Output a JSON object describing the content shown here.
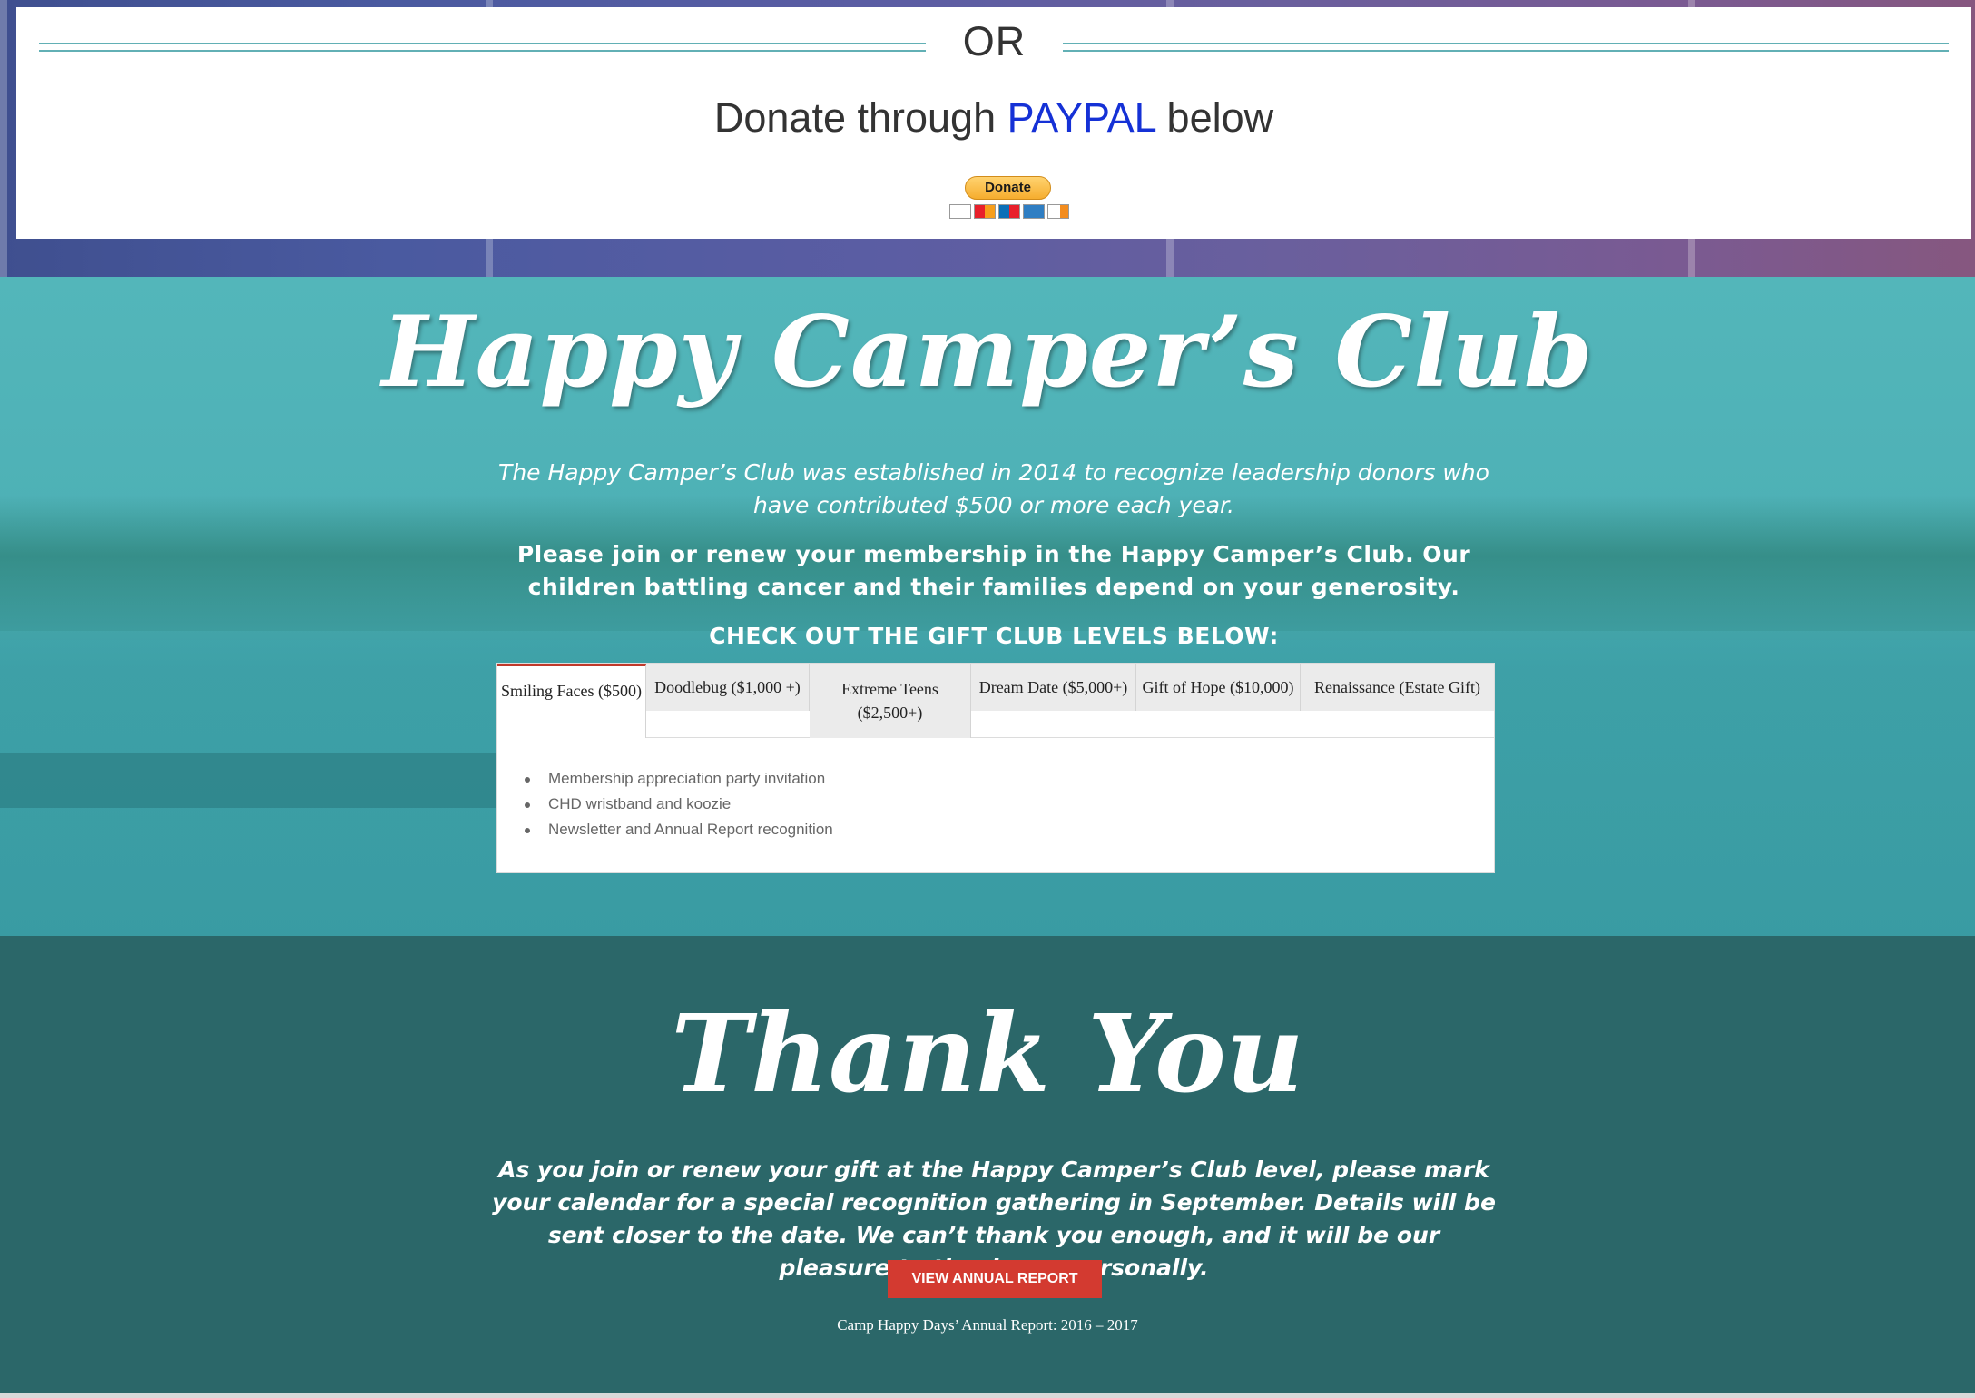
{
  "donate": {
    "divider_text": "OR",
    "heading_prefix": "Donate through",
    "heading_paypal": "PAYPAL",
    "heading_suffix": "below",
    "paypal_button_label": "Donate",
    "card_icons": [
      "visa-icon",
      "mastercard-icon",
      "maestro-icon",
      "amex-icon",
      "discover-icon"
    ]
  },
  "club": {
    "title": "Happy Camper’s Club",
    "intro": "The Happy Camper’s Club was established in 2014 to recognize leadership donors who have contributed $500 or more each year.",
    "join": "Please join or renew your membership in the Happy Camper’s Club. Our children battling cancer and their families depend on your generosity.",
    "levels_heading": "CHECK OUT THE GIFT CLUB LEVELS BELOW:",
    "tabs": [
      {
        "label": "Smiling Faces ($500)",
        "active": true
      },
      {
        "label": "Doodlebug ($1,000 +)",
        "active": false
      },
      {
        "label": "Extreme Teens ($2,500+)",
        "active": false
      },
      {
        "label": "Dream Date ($5,000+)",
        "active": false
      },
      {
        "label": "Gift of Hope ($10,000)",
        "active": false
      },
      {
        "label": "Renaissance (Estate Gift)",
        "active": false
      }
    ],
    "active_tab_items": [
      "Membership appreciation party invitation",
      "CHD wristband and koozie",
      "Newsletter and Annual Report recognition"
    ]
  },
  "thanks": {
    "title": "Thank You",
    "text": "As you join or renew your gift at the Happy Camper’s Club level, please mark your calendar for a special recognition gathering in September. Details will be sent closer to the date. We can’t thank you enough, and it will be our pleasure to thank you personally.",
    "button_label": "VIEW ANNUAL REPORT",
    "caption": "Camp Happy Days’ Annual Report: 2016 – 2017"
  },
  "colors": {
    "accent_teal": "#62b0b5",
    "paypal_blue": "#1531d6",
    "club_bg": "#4eb1b6",
    "thanks_bg": "#2b6769",
    "button_red": "#d33a30",
    "active_tab_border": "#c0392b"
  }
}
